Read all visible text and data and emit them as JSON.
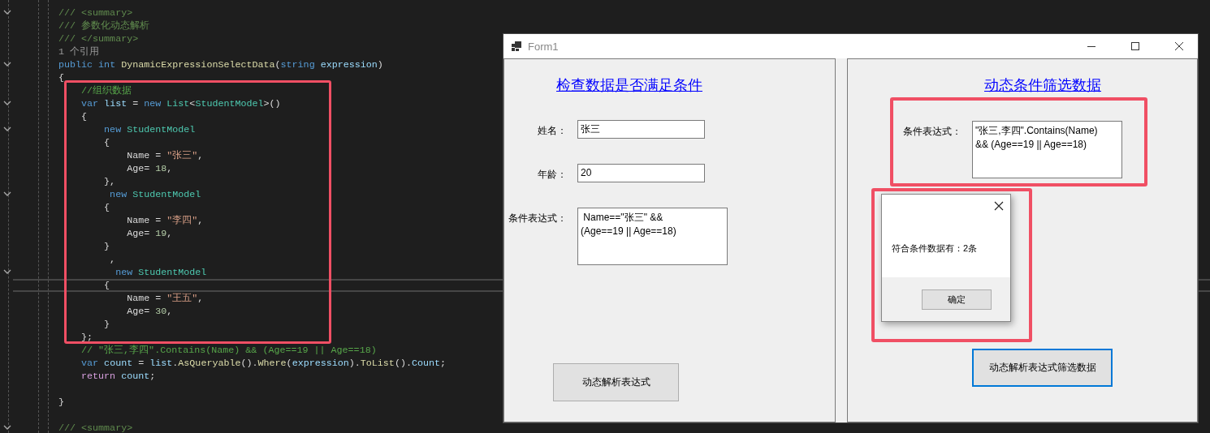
{
  "editor": {
    "lines": [
      {
        "kind": "code",
        "fold": true,
        "current": false,
        "tokens": [
          {
            "text": "/// <summary>",
            "kind": "doc"
          }
        ]
      },
      {
        "kind": "code",
        "fold": false,
        "current": false,
        "tokens": [
          {
            "text": "/// 参数化动态解析",
            "kind": "doc"
          }
        ]
      },
      {
        "kind": "code",
        "fold": false,
        "current": false,
        "tokens": [
          {
            "text": "/// </summary>",
            "kind": "doc"
          }
        ]
      },
      {
        "kind": "code",
        "fold": false,
        "current": false,
        "tokens": [
          {
            "text": "1 个引用",
            "kind": "codelens"
          }
        ]
      },
      {
        "kind": "code",
        "fold": true,
        "current": false,
        "tokens": [
          {
            "text": "public",
            "kind": "keyword"
          },
          {
            "text": " int ",
            "kind": "keyword"
          },
          {
            "text": "DynamicExpressionSelectData",
            "kind": "method"
          },
          {
            "text": "(",
            "kind": "plain"
          },
          {
            "text": "string",
            "kind": "keyword"
          },
          {
            "text": " expression",
            "kind": "param"
          },
          {
            "text": ")",
            "kind": "plain"
          }
        ]
      },
      {
        "kind": "code",
        "fold": false,
        "current": false,
        "tokens": [
          {
            "text": "{",
            "kind": "plain"
          }
        ]
      },
      {
        "kind": "code",
        "fold": false,
        "current": false,
        "tokens": [
          {
            "text": "    //组织数据",
            "kind": "comment"
          }
        ]
      },
      {
        "kind": "code",
        "fold": true,
        "current": false,
        "tokens": [
          {
            "text": "    var",
            "kind": "keyword"
          },
          {
            "text": " list ",
            "kind": "param"
          },
          {
            "text": "= ",
            "kind": "plain"
          },
          {
            "text": "new ",
            "kind": "keyword"
          },
          {
            "text": "List",
            "kind": "type"
          },
          {
            "text": "<",
            "kind": "plain"
          },
          {
            "text": "StudentModel",
            "kind": "type"
          },
          {
            "text": ">()",
            "kind": "plain"
          }
        ]
      },
      {
        "kind": "code",
        "fold": false,
        "current": false,
        "tokens": [
          {
            "text": "    {",
            "kind": "plain"
          }
        ]
      },
      {
        "kind": "code",
        "fold": true,
        "current": false,
        "tokens": [
          {
            "text": "        new ",
            "kind": "keyword"
          },
          {
            "text": "StudentModel",
            "kind": "type"
          }
        ]
      },
      {
        "kind": "code",
        "fold": false,
        "current": false,
        "tokens": [
          {
            "text": "        {",
            "kind": "plain"
          }
        ]
      },
      {
        "kind": "code",
        "fold": false,
        "current": false,
        "tokens": [
          {
            "text": "            Name = ",
            "kind": "plain"
          },
          {
            "text": "\"张三\"",
            "kind": "string"
          },
          {
            "text": ",",
            "kind": "plain"
          }
        ]
      },
      {
        "kind": "code",
        "fold": false,
        "current": false,
        "tokens": [
          {
            "text": "            Age= ",
            "kind": "plain"
          },
          {
            "text": "18",
            "kind": "number"
          },
          {
            "text": ",",
            "kind": "plain"
          }
        ]
      },
      {
        "kind": "code",
        "fold": false,
        "current": false,
        "tokens": [
          {
            "text": "        },",
            "kind": "plain"
          }
        ]
      },
      {
        "kind": "code",
        "fold": true,
        "current": false,
        "tokens": [
          {
            "text": "         new ",
            "kind": "keyword"
          },
          {
            "text": "StudentModel",
            "kind": "type"
          }
        ]
      },
      {
        "kind": "code",
        "fold": false,
        "current": false,
        "tokens": [
          {
            "text": "        {",
            "kind": "plain"
          }
        ]
      },
      {
        "kind": "code",
        "fold": false,
        "current": false,
        "tokens": [
          {
            "text": "            Name = ",
            "kind": "plain"
          },
          {
            "text": "\"李四\"",
            "kind": "string"
          },
          {
            "text": ",",
            "kind": "plain"
          }
        ]
      },
      {
        "kind": "code",
        "fold": false,
        "current": false,
        "tokens": [
          {
            "text": "            Age= ",
            "kind": "plain"
          },
          {
            "text": "19",
            "kind": "number"
          },
          {
            "text": ",",
            "kind": "plain"
          }
        ]
      },
      {
        "kind": "code",
        "fold": false,
        "current": false,
        "tokens": [
          {
            "text": "        }",
            "kind": "plain"
          }
        ]
      },
      {
        "kind": "code",
        "fold": false,
        "current": false,
        "tokens": [
          {
            "text": "         ,",
            "kind": "plain"
          }
        ]
      },
      {
        "kind": "code",
        "fold": true,
        "current": false,
        "tokens": [
          {
            "text": "          new ",
            "kind": "keyword"
          },
          {
            "text": "StudentModel",
            "kind": "type"
          }
        ]
      },
      {
        "kind": "code",
        "fold": false,
        "current": true,
        "tokens": [
          {
            "text": "        {",
            "kind": "plain"
          }
        ]
      },
      {
        "kind": "code",
        "fold": false,
        "current": false,
        "tokens": [
          {
            "text": "            Name = ",
            "kind": "plain"
          },
          {
            "text": "\"王五\"",
            "kind": "string"
          },
          {
            "text": ",",
            "kind": "plain"
          }
        ]
      },
      {
        "kind": "code",
        "fold": false,
        "current": false,
        "tokens": [
          {
            "text": "            Age= ",
            "kind": "plain"
          },
          {
            "text": "30",
            "kind": "number"
          },
          {
            "text": ",",
            "kind": "plain"
          }
        ]
      },
      {
        "kind": "code",
        "fold": false,
        "current": false,
        "tokens": [
          {
            "text": "        }",
            "kind": "plain"
          }
        ]
      },
      {
        "kind": "code",
        "fold": false,
        "current": false,
        "tokens": [
          {
            "text": "    };",
            "kind": "plain"
          }
        ]
      },
      {
        "kind": "code",
        "fold": false,
        "current": false,
        "tokens": [
          {
            "text": "    // \"张三,李四\".Contains(Name) && (Age==19 || Age==18)",
            "kind": "comment"
          }
        ]
      },
      {
        "kind": "code",
        "fold": false,
        "current": false,
        "tokens": [
          {
            "text": "    var",
            "kind": "keyword"
          },
          {
            "text": " count ",
            "kind": "param"
          },
          {
            "text": "= ",
            "kind": "plain"
          },
          {
            "text": "list",
            "kind": "param"
          },
          {
            "text": ".",
            "kind": "plain"
          },
          {
            "text": "AsQueryable",
            "kind": "method"
          },
          {
            "text": "().",
            "kind": "plain"
          },
          {
            "text": "Where",
            "kind": "method"
          },
          {
            "text": "(",
            "kind": "plain"
          },
          {
            "text": "expression",
            "kind": "param"
          },
          {
            "text": ").",
            "kind": "plain"
          },
          {
            "text": "ToList",
            "kind": "method"
          },
          {
            "text": "().",
            "kind": "plain"
          },
          {
            "text": "Count",
            "kind": "param"
          },
          {
            "text": ";",
            "kind": "plain"
          }
        ]
      },
      {
        "kind": "code",
        "fold": false,
        "current": false,
        "tokens": [
          {
            "text": "    return",
            "kind": "control"
          },
          {
            "text": " count",
            "kind": "param"
          },
          {
            "text": ";",
            "kind": "plain"
          }
        ]
      },
      {
        "kind": "blank",
        "fold": false,
        "current": false
      },
      {
        "kind": "code",
        "fold": false,
        "current": false,
        "tokens": [
          {
            "text": "}",
            "kind": "plain"
          }
        ]
      },
      {
        "kind": "blank",
        "fold": false,
        "current": false
      },
      {
        "kind": "code",
        "fold": true,
        "current": false,
        "tokens": [
          {
            "text": "/// <summary>",
            "kind": "doc"
          }
        ]
      }
    ]
  },
  "window": {
    "title": "Form1",
    "left_panel": {
      "title": "检查数据是否满足条件",
      "fields": [
        {
          "label": "姓名：",
          "value": "张三",
          "kind": "line"
        },
        {
          "label": "年龄：",
          "value": "20",
          "kind": "line"
        },
        {
          "label": "条件表达式：",
          "value": " Name==\"张三\" &&\n(Age==19 || Age==18)",
          "kind": "multiline"
        }
      ],
      "button": {
        "label": "动态解析表达式",
        "focused": false
      }
    },
    "right_panel": {
      "title": "动态条件筛选数据",
      "fields": [
        {
          "label": "条件表达式：",
          "value": "\"张三,李四\".Contains(Name)\n&& (Age==19 || Age==18)",
          "kind": "multiline"
        }
      ],
      "button": {
        "label": "动态解析表达式筛选数据",
        "focused": true
      }
    },
    "message_box": {
      "text": "符合条件数据有：2条",
      "button": "确定"
    }
  }
}
